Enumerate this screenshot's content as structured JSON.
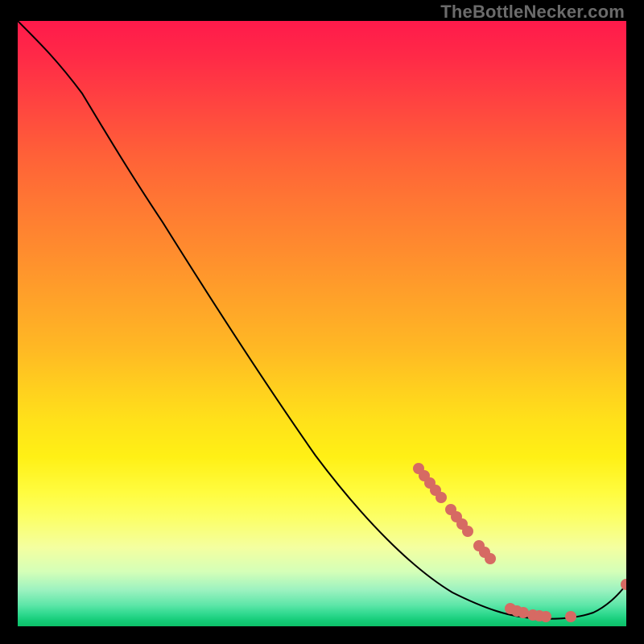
{
  "attribution": "TheBottleNecker.com",
  "colors": {
    "gradient_top": "#ff1a4b",
    "gradient_mid": "#ffe11a",
    "gradient_bottom": "#0cbf68",
    "curve": "#000000",
    "markers": "#d66a63",
    "background": "#000000",
    "attribution_text": "#6b6b6b"
  },
  "chart_data": {
    "type": "line",
    "title": "",
    "xlabel": "",
    "ylabel": "",
    "xlim": [
      0,
      100
    ],
    "ylim": [
      0,
      100
    ],
    "series": [
      {
        "name": "bottleneck-curve",
        "x": [
          0,
          4,
          11,
          15,
          19,
          24,
          30,
          40,
          49,
          57,
          65,
          71,
          77,
          81,
          85,
          89,
          92,
          95,
          97,
          99,
          100
        ],
        "y": [
          100,
          96,
          88,
          81,
          75,
          67,
          56,
          41,
          28,
          18,
          11,
          6,
          3,
          1.8,
          1.3,
          1.2,
          1.3,
          1.7,
          2.3,
          4.2,
          6.9
        ]
      }
    ],
    "markers": [
      {
        "name": "upper-cluster",
        "x": [
          66,
          67,
          68,
          69,
          70,
          71,
          72,
          73,
          74,
          76,
          77,
          78
        ],
        "y": [
          26,
          25,
          24,
          22,
          21,
          19,
          18,
          17,
          16,
          13,
          12,
          11
        ]
      },
      {
        "name": "bottom-cluster",
        "x": [
          81,
          82,
          83,
          85,
          86,
          87,
          91,
          100
        ],
        "y": [
          2.9,
          2.5,
          2.3,
          1.9,
          1.7,
          1.6,
          1.6,
          6.9
        ]
      }
    ],
    "background": {
      "type": "vertical-gradient",
      "description": "red at top through orange/yellow to green at bottom, indicating bottleneck severity scale"
    }
  }
}
